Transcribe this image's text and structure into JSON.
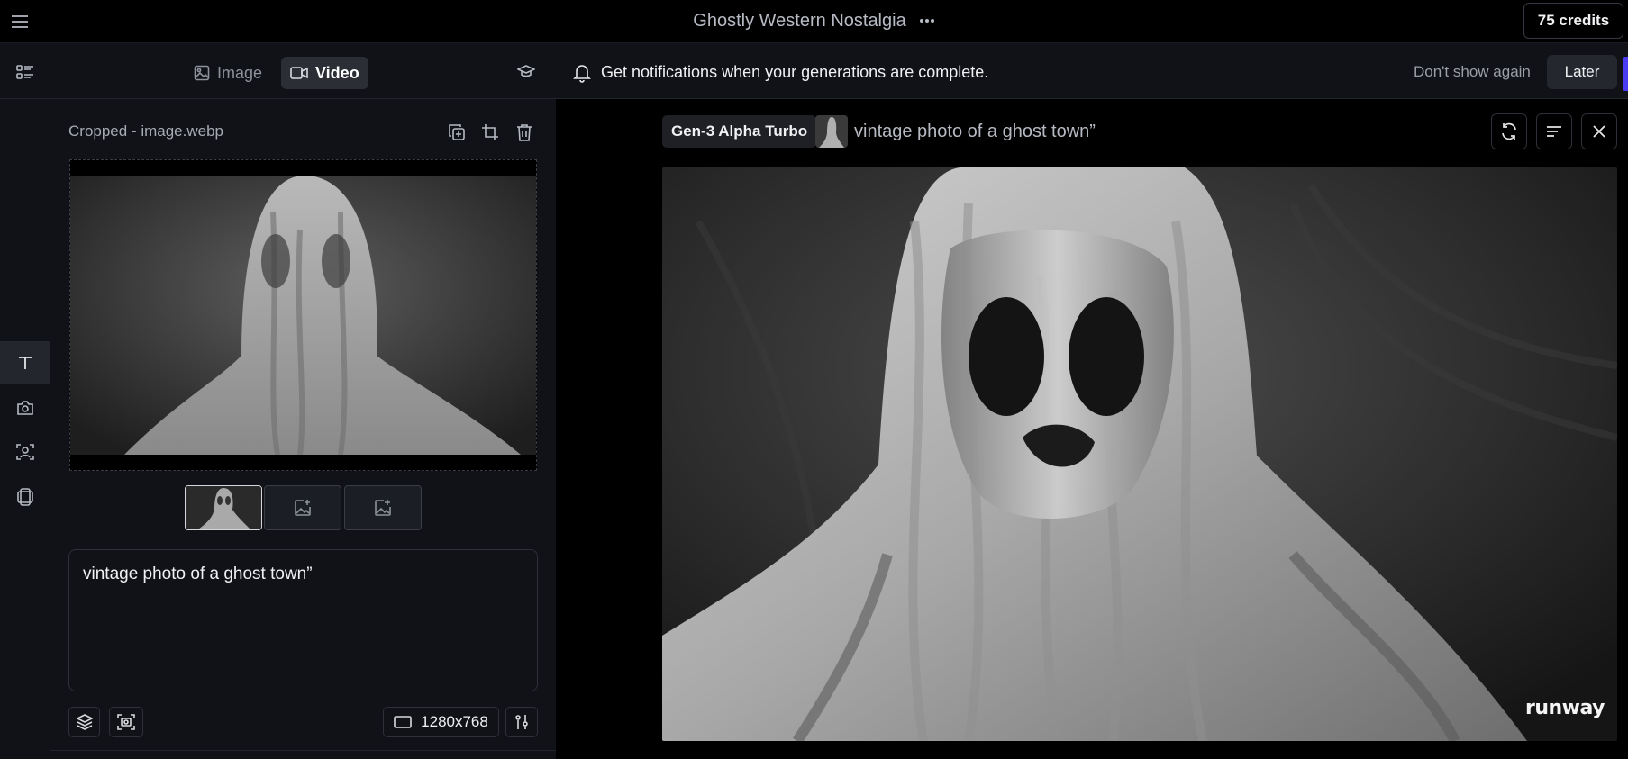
{
  "header": {
    "project_title": "Ghostly Western Nostalgia",
    "more_icon": "ellipsis-icon",
    "credits": "75 credits"
  },
  "modes": {
    "image_label": "Image",
    "video_label": "Video",
    "active": "Video"
  },
  "sidebar": {
    "tools": [
      "text-icon",
      "camera-icon",
      "face-scan-icon",
      "frames-icon"
    ],
    "active_tool": "text-icon"
  },
  "panel": {
    "file_name": "Cropped - image.webp",
    "prompt": "vintage photo of a ghost town”",
    "resolution": "1280x768"
  },
  "notification": {
    "text": "Get notifications when your generations are complete.",
    "dismiss_label": "Don't show again",
    "later_label": "Later"
  },
  "generation": {
    "model": "Gen-3 Alpha Turbo",
    "prompt": "vintage photo of a ghost town”",
    "watermark": "runway"
  },
  "colors": {
    "background": "#000000",
    "panel": "#101217",
    "accent": "#4a3cf0"
  }
}
